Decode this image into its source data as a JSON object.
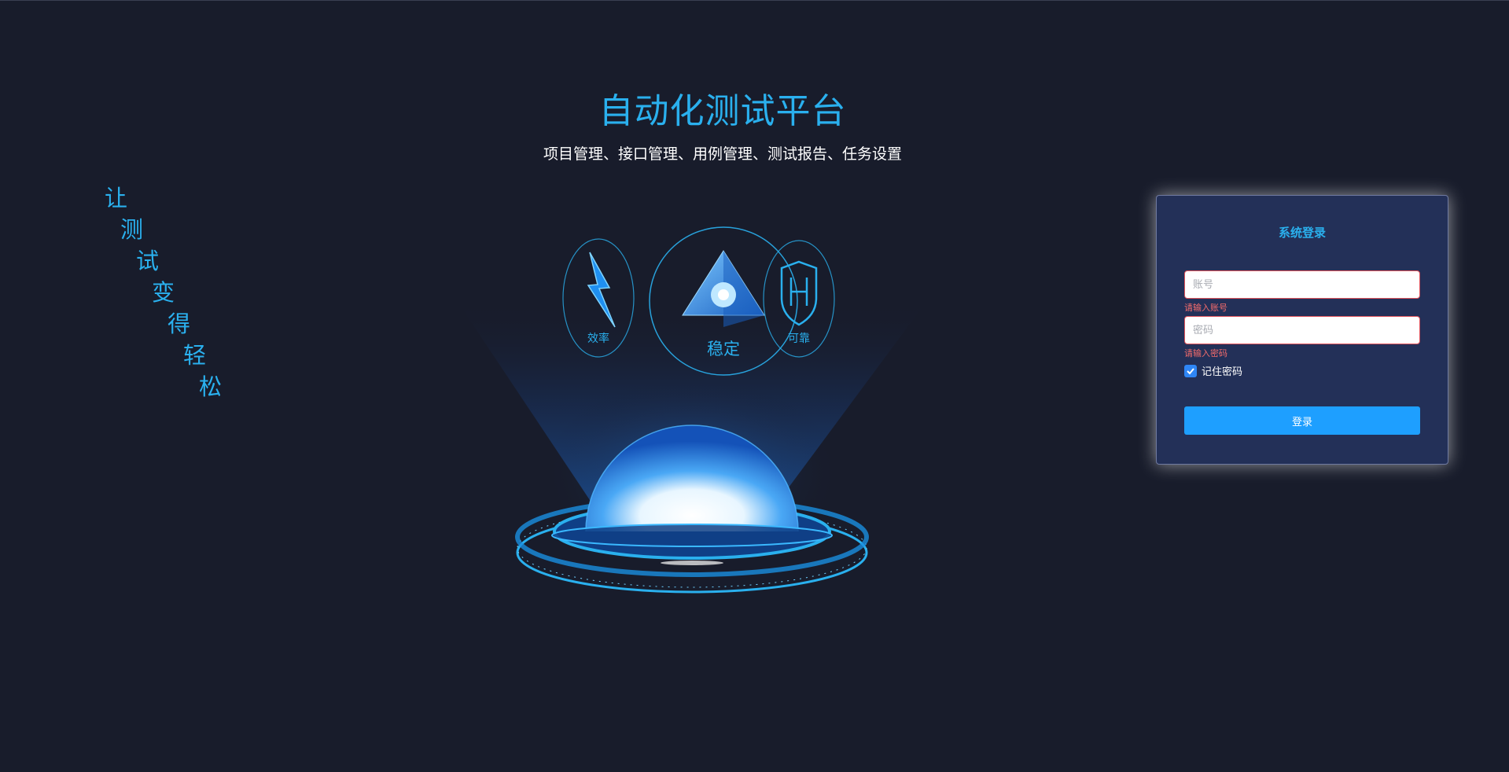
{
  "header": {
    "title": "自动化测试平台",
    "subtitle": "项目管理、接口管理、用例管理、测试报告、任务设置"
  },
  "slogan": {
    "chars": [
      "让",
      "测",
      "试",
      "变",
      "得",
      "轻",
      "松"
    ]
  },
  "hologram": {
    "labels": {
      "left": "效率",
      "center": "稳定",
      "right": "可靠"
    }
  },
  "login": {
    "title": "系统登录",
    "account_placeholder": "账号",
    "account_value": "",
    "account_error": "请输入账号",
    "password_placeholder": "密码",
    "password_value": "",
    "password_error": "请输入密码",
    "remember_label": "记住密码",
    "remember_checked": true,
    "submit_label": "登录"
  },
  "colors": {
    "background": "#181c2b",
    "accent": "#2ab0ee",
    "card": "#233058",
    "button": "#1e9fff",
    "error": "#f56c6c"
  }
}
